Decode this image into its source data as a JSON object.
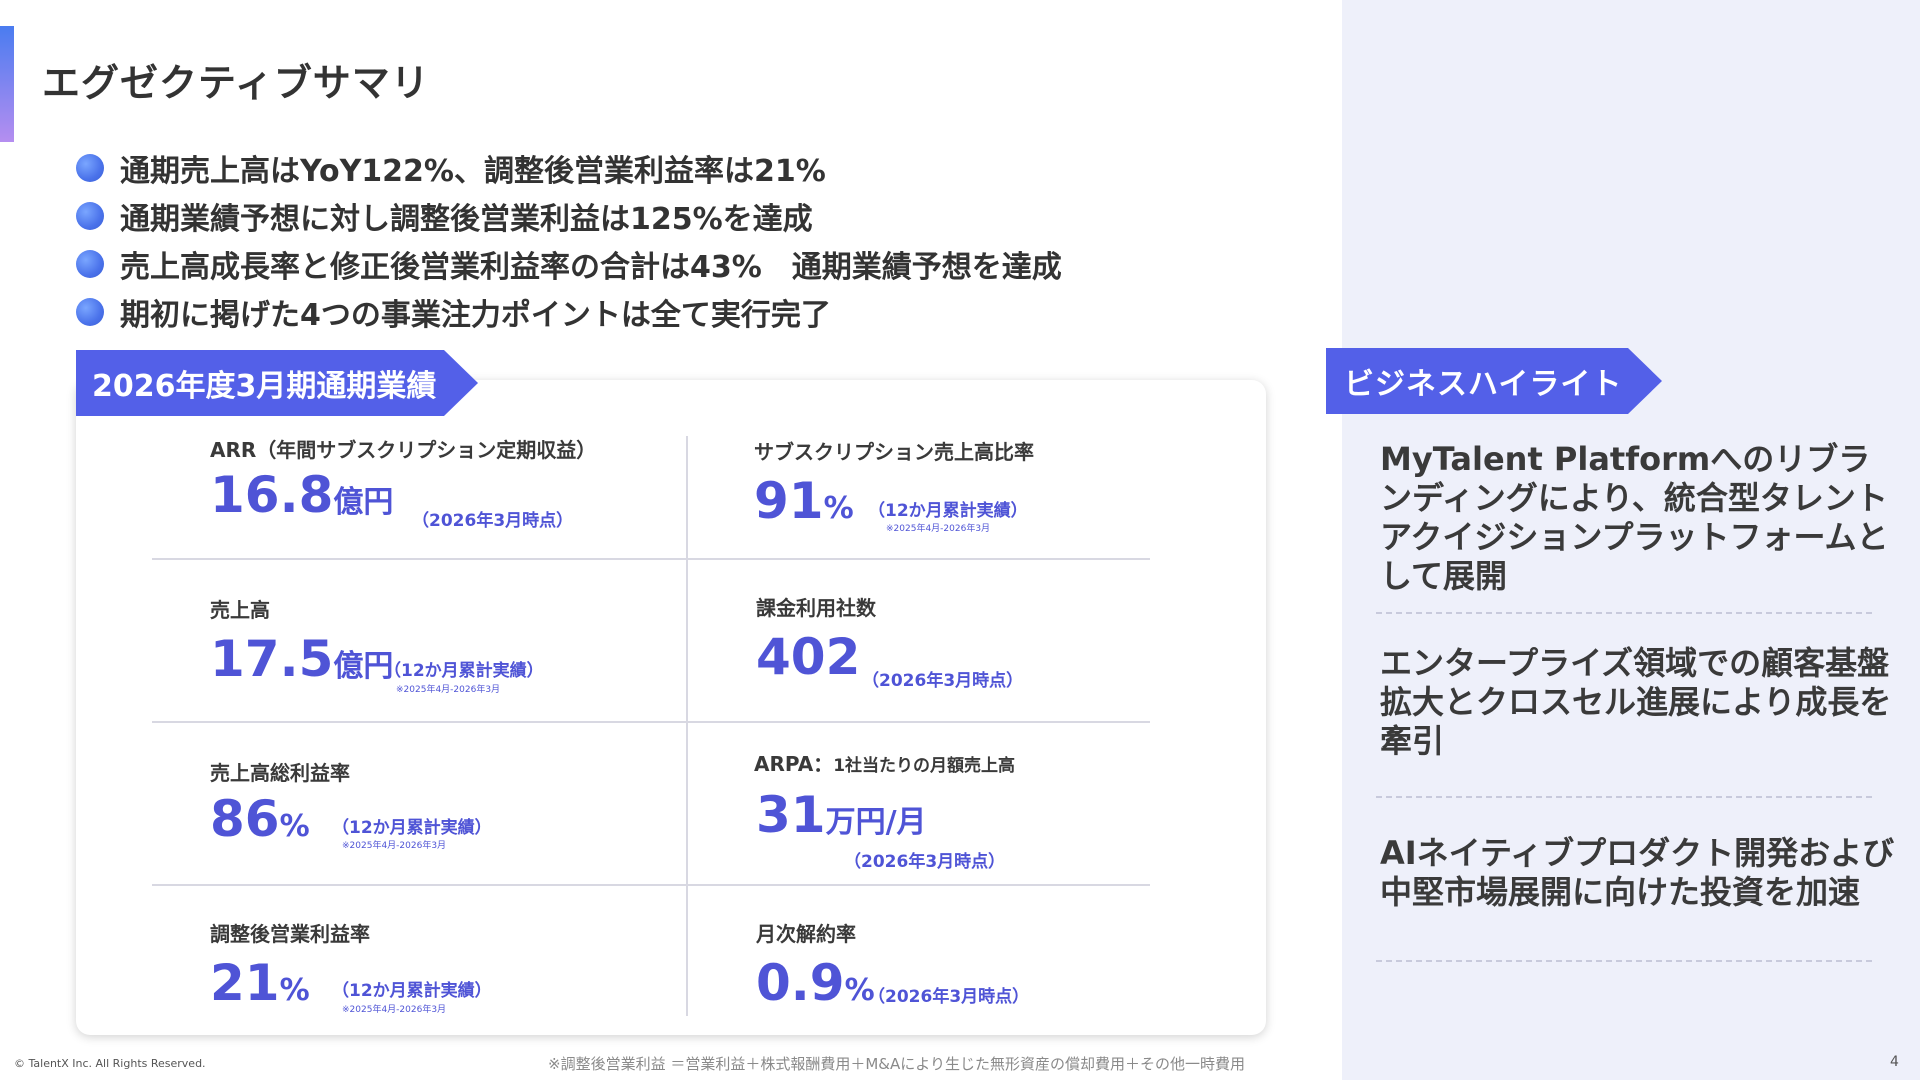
{
  "title": "エグゼクティブサマリ",
  "bullets": [
    "通期売上高はYoY122%、調整後営業利益率は21%",
    "通期業績予想に対し調整後営業利益は125%を達成",
    "売上高成長率と修正後営業利益率の合計は43%　通期業績予想を達成",
    "期初に掲げた4つの事業注力ポイントは全て実行完了"
  ],
  "results_ribbon": "2026年度3月期通期業績",
  "metrics": {
    "arr": {
      "label": "ARR（年間サブスクリプション定期収益）",
      "value": "16.8",
      "unit": "億円",
      "note": "（2026年3月時点）"
    },
    "sub_ratio": {
      "label": "サブスクリプション売上高比率",
      "value": "91",
      "unit": "%",
      "note": "（12か月累計実績）",
      "period": "※2025年4月-2026年3月"
    },
    "revenue": {
      "label": "売上高",
      "value": "17.5",
      "unit": "億円",
      "note": "（12か月累計実績）",
      "period": "※2025年4月-2026年3月"
    },
    "paying_companies": {
      "label": "課金利用社数",
      "value": "402",
      "note": "（2026年3月時点）"
    },
    "gross_margin": {
      "label": "売上高総利益率",
      "value": "86",
      "unit": "%",
      "note": "（12か月累計実績）",
      "period": "※2025年4月-2026年3月"
    },
    "arpa": {
      "label": "ARPA：",
      "label_sub": "1社当たりの月額売上高",
      "value": "31",
      "unit": "万円/月",
      "note": "（2026年3月時点）"
    },
    "adj_op_margin": {
      "label": "調整後営業利益率",
      "value": "21",
      "unit": "%",
      "note": "（12か月累計実績）",
      "period": "※2025年4月-2026年3月"
    },
    "churn": {
      "label": "月次解約率",
      "value": "0.9",
      "unit": "%",
      "note": "（2026年3月時点）"
    }
  },
  "highlights_ribbon": "ビジネスハイライト",
  "highlights": [
    "MyTalent Platformへのリブランディングにより、統合型タレントアクイジションプラットフォームとして展開",
    "エンタープライズ領域での顧客基盤拡大とクロスセル進展により成長を牽引",
    "AIネイティブプロダクト開発および中堅市場展開に向けた投資を加速"
  ],
  "copyright": "© TalentX Inc. All Rights Reserved.",
  "footnote": "※調整後営業利益 ＝営業利益＋株式報酬費用＋M&Aにより生じた無形資産の償却費用＋その他一時費用",
  "page_number": "4"
}
